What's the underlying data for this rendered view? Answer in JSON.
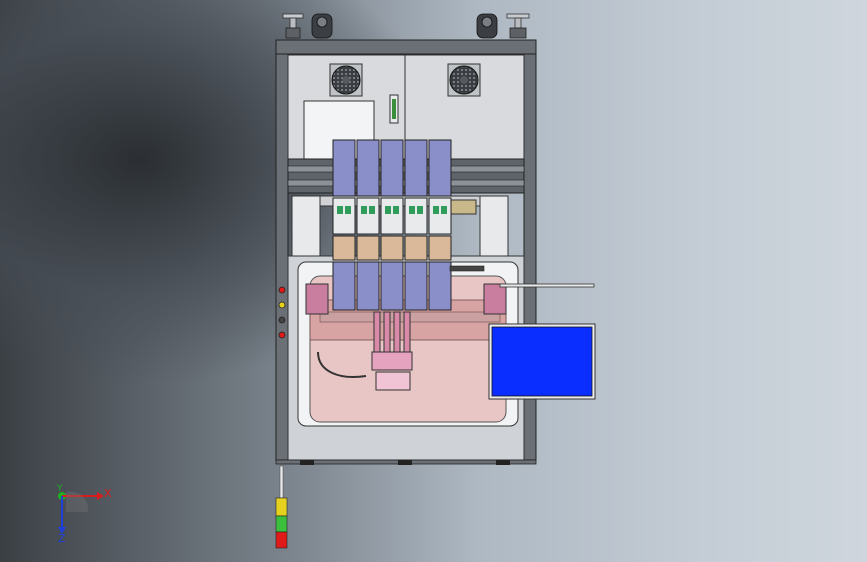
{
  "triad": {
    "x_label": "X",
    "y_label": "Y",
    "z_label": "Z"
  },
  "colors": {
    "frame": "#5b6167",
    "panel": "#d8dade",
    "chamber": "#e9c6c6",
    "screen": "#0a2eff",
    "module": "#8a8fc9",
    "lamp_green": "#3cbf3c",
    "lamp_red": "#e01919",
    "lamp_yellow": "#e6d21e"
  }
}
